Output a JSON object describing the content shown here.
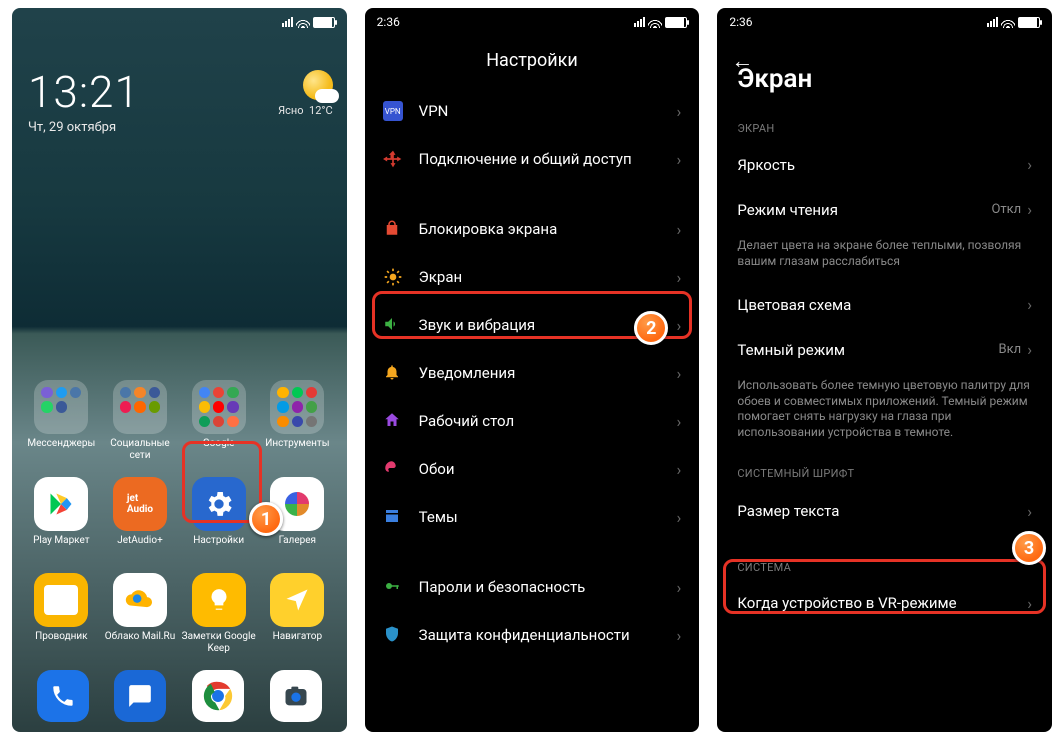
{
  "callouts": {
    "one": "1",
    "two": "2",
    "three": "3"
  },
  "screen1": {
    "status_time": "",
    "clock": "13:21",
    "date": "Чт, 29 октября",
    "weather_cond": "Ясно",
    "weather_temp": "12°C",
    "apps": [
      {
        "label": "Мессенджеры"
      },
      {
        "label": "Социальные сети"
      },
      {
        "label": "Google"
      },
      {
        "label": "Инструменты"
      },
      {
        "label": "Play Маркет"
      },
      {
        "label": "JetAudio+"
      },
      {
        "label": "Настройки"
      },
      {
        "label": "Галерея"
      },
      {
        "label": "Проводник"
      },
      {
        "label": "Облако Mail.Ru"
      },
      {
        "label": "Заметки Google Keep"
      },
      {
        "label": "Навигатор"
      }
    ]
  },
  "screen2": {
    "status_time": "2:36",
    "title": "Настройки",
    "items": [
      {
        "label": "VPN"
      },
      {
        "label": "Подключение и общий доступ"
      },
      {
        "label": "Блокировка экрана"
      },
      {
        "label": "Экран"
      },
      {
        "label": "Звук и вибрация"
      },
      {
        "label": "Уведомления"
      },
      {
        "label": "Рабочий стол"
      },
      {
        "label": "Обои"
      },
      {
        "label": "Темы"
      },
      {
        "label": "Пароли и безопасность"
      },
      {
        "label": "Защита конфиденциальности"
      }
    ]
  },
  "screen3": {
    "status_time": "2:36",
    "title": "Экран",
    "section1": "ЭКРАН",
    "brightness": "Яркость",
    "reading": {
      "title": "Режим чтения",
      "sub": "Делает цвета на экране более теплыми, позволяя вашим глазам расслабиться",
      "value": "Откл"
    },
    "scheme": "Цветовая схема",
    "dark": {
      "title": "Темный режим",
      "sub": "Использовать более темную цветовую палитру для обоев и совместимых приложений. Темный режим помогает снять нагрузку на глаза при использовании устройства в темноте.",
      "value": "Вкл"
    },
    "section2": "СИСТЕМНЫЙ ШРИФТ",
    "textsize": "Размер текста",
    "section3": "СИСТЕМА",
    "vr": "Когда устройство в VR-режиме"
  }
}
